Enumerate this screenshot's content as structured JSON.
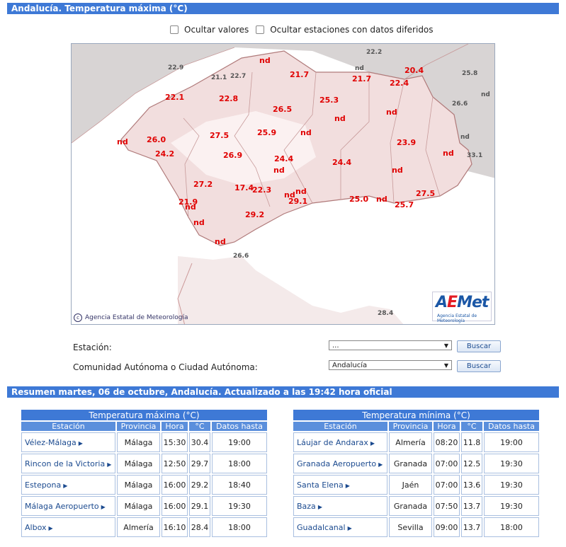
{
  "header": {
    "title": "Andalucía. Temperatura máxima (°C)"
  },
  "options": {
    "hide_values": "Ocultar valores",
    "hide_deferred": "Ocultar estaciones con datos diferidos"
  },
  "map": {
    "credit": "Agencia Estatal de Meteorología",
    "logo_name": "AEMet",
    "logo_sub": "Agencia Estatal de Meteorología",
    "values_red": [
      "nd",
      "21.7",
      "20.4",
      "21.7",
      "22.4",
      "22.1",
      "22.8",
      "25.3",
      "26.5",
      "nd",
      "nd",
      "27.5",
      "25.9",
      "nd",
      "26.0",
      "nd",
      "23.9",
      "24.2",
      "26.9",
      "24.4",
      "nd",
      "24.4",
      "nd",
      "nd",
      "27.2",
      "17.4",
      "22.3",
      "nd",
      "25.0",
      "nd",
      "27.5",
      "21.9",
      "nd",
      "29.1",
      "25.7",
      "nd",
      "29.2",
      "nd",
      "nd"
    ],
    "values_gray": [
      "22.2",
      "22.9",
      "21.1",
      "22.7",
      "nd",
      "25.8",
      "nd",
      "26.6",
      "nd",
      "33.1",
      "26.6",
      "28.4"
    ]
  },
  "form": {
    "station_label": "Estación:",
    "station_value": "...",
    "community_label": "Comunidad Autónoma o Ciudad Autónoma:",
    "community_value": "Andalucía",
    "search_label": "Buscar"
  },
  "summary": {
    "title": "Resumen martes, 06 de octubre, Andalucía. Actualizado a las 19:42 hora oficial"
  },
  "tables": {
    "headers": [
      "Estación",
      "Provincia",
      "Hora",
      "°C",
      "Datos hasta"
    ],
    "max": {
      "title": "Temperatura máxima (°C)",
      "rows": [
        [
          "Vélez-Málaga",
          "Málaga",
          "15:30",
          "30.4",
          "19:00"
        ],
        [
          "Rincon de la Victoria",
          "Málaga",
          "12:50",
          "29.7",
          "18:00"
        ],
        [
          "Estepona",
          "Málaga",
          "16:00",
          "29.2",
          "18:40"
        ],
        [
          "Málaga Aeropuerto",
          "Málaga",
          "16:00",
          "29.1",
          "19:30"
        ],
        [
          "Albox",
          "Almería",
          "16:10",
          "28.4",
          "18:00"
        ]
      ]
    },
    "min": {
      "title": "Temperatura mínima (°C)",
      "rows": [
        [
          "Láujar de Andarax",
          "Almería",
          "08:20",
          "11.8",
          "19:00"
        ],
        [
          "Granada Aeropuerto",
          "Granada",
          "07:00",
          "12.5",
          "19:30"
        ],
        [
          "Santa Elena",
          "Jaén",
          "07:00",
          "13.6",
          "19:30"
        ],
        [
          "Baza",
          "Granada",
          "07:50",
          "13.7",
          "19:30"
        ],
        [
          "Guadalcanal",
          "Sevilla",
          "09:00",
          "13.7",
          "18:00"
        ]
      ]
    }
  }
}
